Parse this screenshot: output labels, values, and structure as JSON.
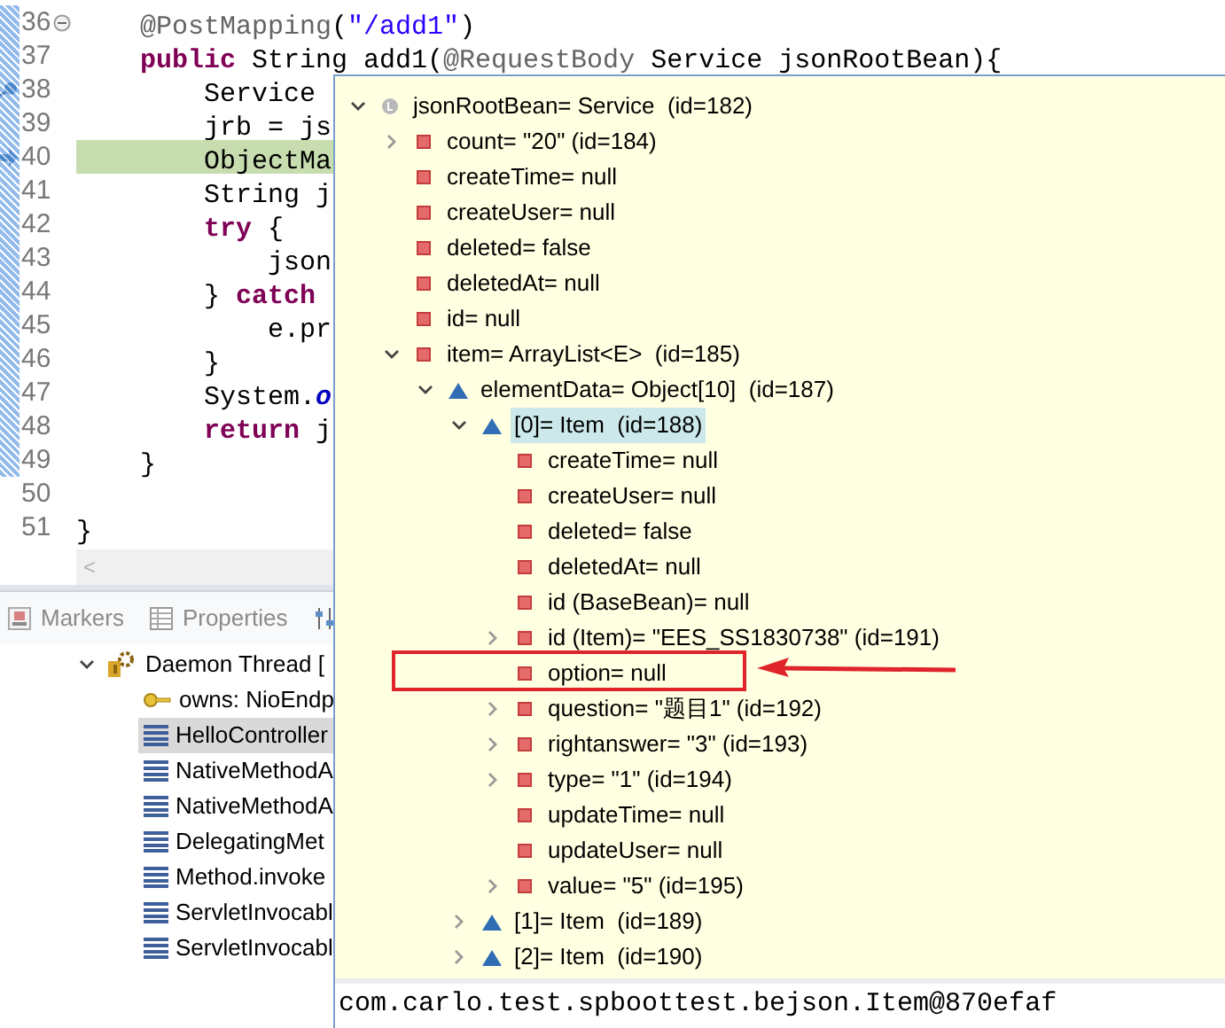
{
  "editor": {
    "lines": [
      {
        "number": "36",
        "kind": "plain",
        "fold_toggle": true,
        "current": false,
        "tokens": [
          {
            "kind": "annotation",
            "text": "    @PostMapping"
          },
          {
            "kind": "plain",
            "text": "("
          },
          {
            "kind": "string",
            "text": "\"/add1\""
          },
          {
            "kind": "plain",
            "text": ")"
          }
        ]
      },
      {
        "number": "37",
        "kind": "plain",
        "fold_toggle": false,
        "current": false,
        "tokens": [
          {
            "kind": "keyword",
            "text": "    public"
          },
          {
            "kind": "plain",
            "text": " String add1("
          },
          {
            "kind": "annotation",
            "text": "@RequestBody"
          },
          {
            "kind": "plain",
            "text": " Service jsonRootBean){"
          }
        ]
      },
      {
        "number": "38",
        "kind": "breakpoint",
        "fold_toggle": false,
        "current": false,
        "tokens": [
          {
            "kind": "plain",
            "text": "        Service"
          }
        ]
      },
      {
        "number": "39",
        "kind": "plain",
        "fold_toggle": false,
        "current": false,
        "tokens": [
          {
            "kind": "plain",
            "text": "        jrb = js"
          }
        ]
      },
      {
        "number": "40",
        "kind": "instruction",
        "fold_toggle": false,
        "current": true,
        "tokens": [
          {
            "kind": "plain",
            "text": "        ObjectMa"
          }
        ]
      },
      {
        "number": "41",
        "kind": "plain",
        "fold_toggle": false,
        "current": false,
        "tokens": [
          {
            "kind": "plain",
            "text": "        String j"
          }
        ]
      },
      {
        "number": "42",
        "kind": "plain",
        "fold_toggle": false,
        "current": false,
        "tokens": [
          {
            "kind": "keyword",
            "text": "        try"
          },
          {
            "kind": "plain",
            "text": " {"
          }
        ]
      },
      {
        "number": "43",
        "kind": "plain",
        "fold_toggle": false,
        "current": false,
        "tokens": [
          {
            "kind": "plain",
            "text": "            json"
          }
        ]
      },
      {
        "number": "44",
        "kind": "plain",
        "fold_toggle": false,
        "current": false,
        "tokens": [
          {
            "kind": "plain",
            "text": "        } "
          },
          {
            "kind": "keyword",
            "text": "catch"
          }
        ]
      },
      {
        "number": "45",
        "kind": "plain",
        "fold_toggle": false,
        "current": false,
        "tokens": [
          {
            "kind": "plain",
            "text": "            e.pr"
          }
        ]
      },
      {
        "number": "46",
        "kind": "plain",
        "fold_toggle": false,
        "current": false,
        "tokens": [
          {
            "kind": "plain",
            "text": "        }"
          }
        ]
      },
      {
        "number": "47",
        "kind": "plain",
        "fold_toggle": false,
        "current": false,
        "tokens": [
          {
            "kind": "plain",
            "text": "        System."
          },
          {
            "kind": "field",
            "text": "o"
          }
        ]
      },
      {
        "number": "48",
        "kind": "plain",
        "fold_toggle": false,
        "current": false,
        "tokens": [
          {
            "kind": "keyword",
            "text": "        return"
          },
          {
            "kind": "plain",
            "text": " j"
          }
        ]
      },
      {
        "number": "49",
        "kind": "plain",
        "fold_toggle": false,
        "current": false,
        "tokens": [
          {
            "kind": "plain",
            "text": "    }"
          }
        ]
      },
      {
        "number": "50",
        "kind": "plain",
        "fold_toggle": false,
        "current": false
      },
      {
        "number": "51",
        "kind": "plain",
        "fold_toggle": false,
        "current": false,
        "tokens": [
          {
            "kind": "plain",
            "text": "}"
          }
        ]
      }
    ],
    "scroll_left": "<"
  },
  "panel": {
    "tabs": [
      {
        "label": "Markers",
        "kind": "markers"
      },
      {
        "label": "Properties",
        "kind": "properties"
      },
      {
        "kind": "sliders"
      }
    ],
    "threads": [
      {
        "label": "Daemon Thread [",
        "expanded": true,
        "selected": false,
        "children": [
          {
            "label": "owns: NioEndp",
            "kind": "monitor",
            "selected": false
          },
          {
            "label": "HelloController",
            "kind": "frame",
            "selected": true
          },
          {
            "label": "NativeMethodA",
            "kind": "frame",
            "selected": false
          },
          {
            "label": "NativeMethodA",
            "kind": "frame",
            "selected": false
          },
          {
            "label": "DelegatingMet",
            "kind": "frame",
            "selected": false
          },
          {
            "label": "Method.invoke",
            "kind": "frame",
            "selected": false
          },
          {
            "label": "ServletInvocabl",
            "kind": "frame",
            "selected": false
          },
          {
            "label": "ServletInvocabl",
            "kind": "frame",
            "selected": false
          }
        ]
      }
    ]
  },
  "inspector": {
    "tree": [
      {
        "text": "jsonRootBean= Service  (id=182)",
        "kind": "local",
        "expanded": true,
        "selected": false,
        "marked": false,
        "children": [
          {
            "text": "count= \"20\" (id=184)",
            "kind": "field",
            "expanded": false,
            "selected": false,
            "marked": false
          },
          {
            "text": "createTime= null",
            "kind": "field",
            "selected": false,
            "marked": false
          },
          {
            "text": "createUser= null",
            "kind": "field",
            "selected": false,
            "marked": false
          },
          {
            "text": "deleted= false",
            "kind": "field",
            "selected": false,
            "marked": false
          },
          {
            "text": "deletedAt= null",
            "kind": "field",
            "selected": false,
            "marked": false
          },
          {
            "text": "id= null",
            "kind": "field",
            "selected": false,
            "marked": false
          },
          {
            "text": "item= ArrayList<E>  (id=185)",
            "kind": "field",
            "expanded": true,
            "selected": false,
            "marked": false,
            "children": [
              {
                "text": "elementData= Object[10]  (id=187)",
                "kind": "element",
                "expanded": true,
                "selected": false,
                "marked": false,
                "children": [
                  {
                    "text": "[0]= Item  (id=188)",
                    "kind": "element",
                    "expanded": true,
                    "selected": true,
                    "marked": false,
                    "children": [
                      {
                        "text": "createTime= null",
                        "kind": "field",
                        "selected": false,
                        "marked": false
                      },
                      {
                        "text": "createUser= null",
                        "kind": "field",
                        "selected": false,
                        "marked": false
                      },
                      {
                        "text": "deleted= false",
                        "kind": "field",
                        "selected": false,
                        "marked": false
                      },
                      {
                        "text": "deletedAt= null",
                        "kind": "field",
                        "selected": false,
                        "marked": false
                      },
                      {
                        "text": "id (BaseBean)= null",
                        "kind": "field",
                        "selected": false,
                        "marked": false
                      },
                      {
                        "text": "id (Item)= \"EES_SS1830738\" (id=191)",
                        "kind": "field",
                        "expanded": false,
                        "selected": false,
                        "marked": false
                      },
                      {
                        "text": "option= null",
                        "kind": "field",
                        "selected": false,
                        "marked": true
                      },
                      {
                        "text": "question= \"题目1\" (id=192)",
                        "kind": "field",
                        "expanded": false,
                        "selected": false,
                        "marked": false
                      },
                      {
                        "text": "rightanswer= \"3\" (id=193)",
                        "kind": "field",
                        "expanded": false,
                        "selected": false,
                        "marked": false
                      },
                      {
                        "text": "type= \"1\" (id=194)",
                        "kind": "field",
                        "expanded": false,
                        "selected": false,
                        "marked": false
                      },
                      {
                        "text": "updateTime= null",
                        "kind": "field",
                        "selected": false,
                        "marked": false
                      },
                      {
                        "text": "updateUser= null",
                        "kind": "field",
                        "selected": false,
                        "marked": false
                      },
                      {
                        "text": "value= \"5\" (id=195)",
                        "kind": "field",
                        "expanded": false,
                        "selected": false,
                        "marked": false
                      }
                    ]
                  },
                  {
                    "text": "[1]= Item  (id=189)",
                    "kind": "element",
                    "expanded": false,
                    "selected": false,
                    "marked": false
                  },
                  {
                    "text": "[2]= Item  (id=190)",
                    "kind": "element",
                    "expanded": false,
                    "selected": false,
                    "marked": false
                  }
                ]
              }
            ]
          }
        ]
      }
    ],
    "detail": "com.carlo.test.spboottest.bejson.Item@870efaf"
  }
}
